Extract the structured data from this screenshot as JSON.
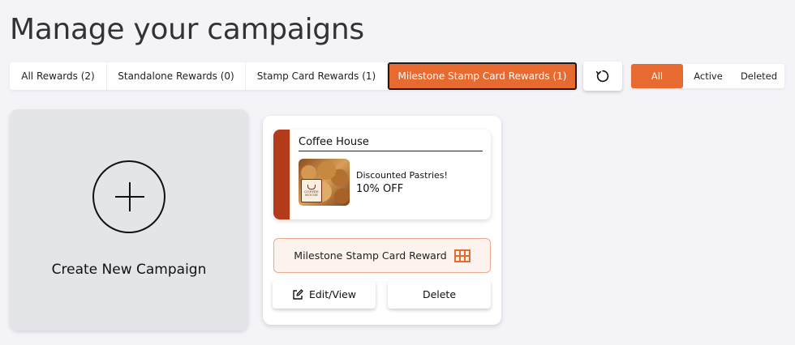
{
  "page": {
    "title": "Manage your campaigns"
  },
  "tabs": [
    {
      "label": "All Rewards (2)",
      "active": false
    },
    {
      "label": "Standalone Rewards (0)",
      "active": false
    },
    {
      "label": "Stamp Card Rewards (1)",
      "active": false
    },
    {
      "label": "Milestone Stamp Card Rewards (1)",
      "active": true
    }
  ],
  "refresh": {
    "icon": "refresh-icon"
  },
  "filters": [
    {
      "label": "All",
      "active": true
    },
    {
      "label": "Active",
      "active": false
    },
    {
      "label": "Deleted",
      "active": false
    }
  ],
  "create_card": {
    "label": "Create New Campaign",
    "icon": "plus-circle-icon"
  },
  "campaign": {
    "business_name": "Coffee House",
    "reward_title": "Discounted Pastries!",
    "reward_value": "10% OFF",
    "logo_text_top": "COFFEE",
    "logo_text_bottom": "HOUSE",
    "type_label": "Milestone Stamp Card Reward",
    "type_icon": "grid-icon",
    "edit_label": "Edit/View",
    "edit_icon": "edit-icon",
    "delete_label": "Delete"
  },
  "colors": {
    "accent": "#e76a30",
    "stripe": "#b33b1a",
    "background": "#f4f3f8"
  }
}
